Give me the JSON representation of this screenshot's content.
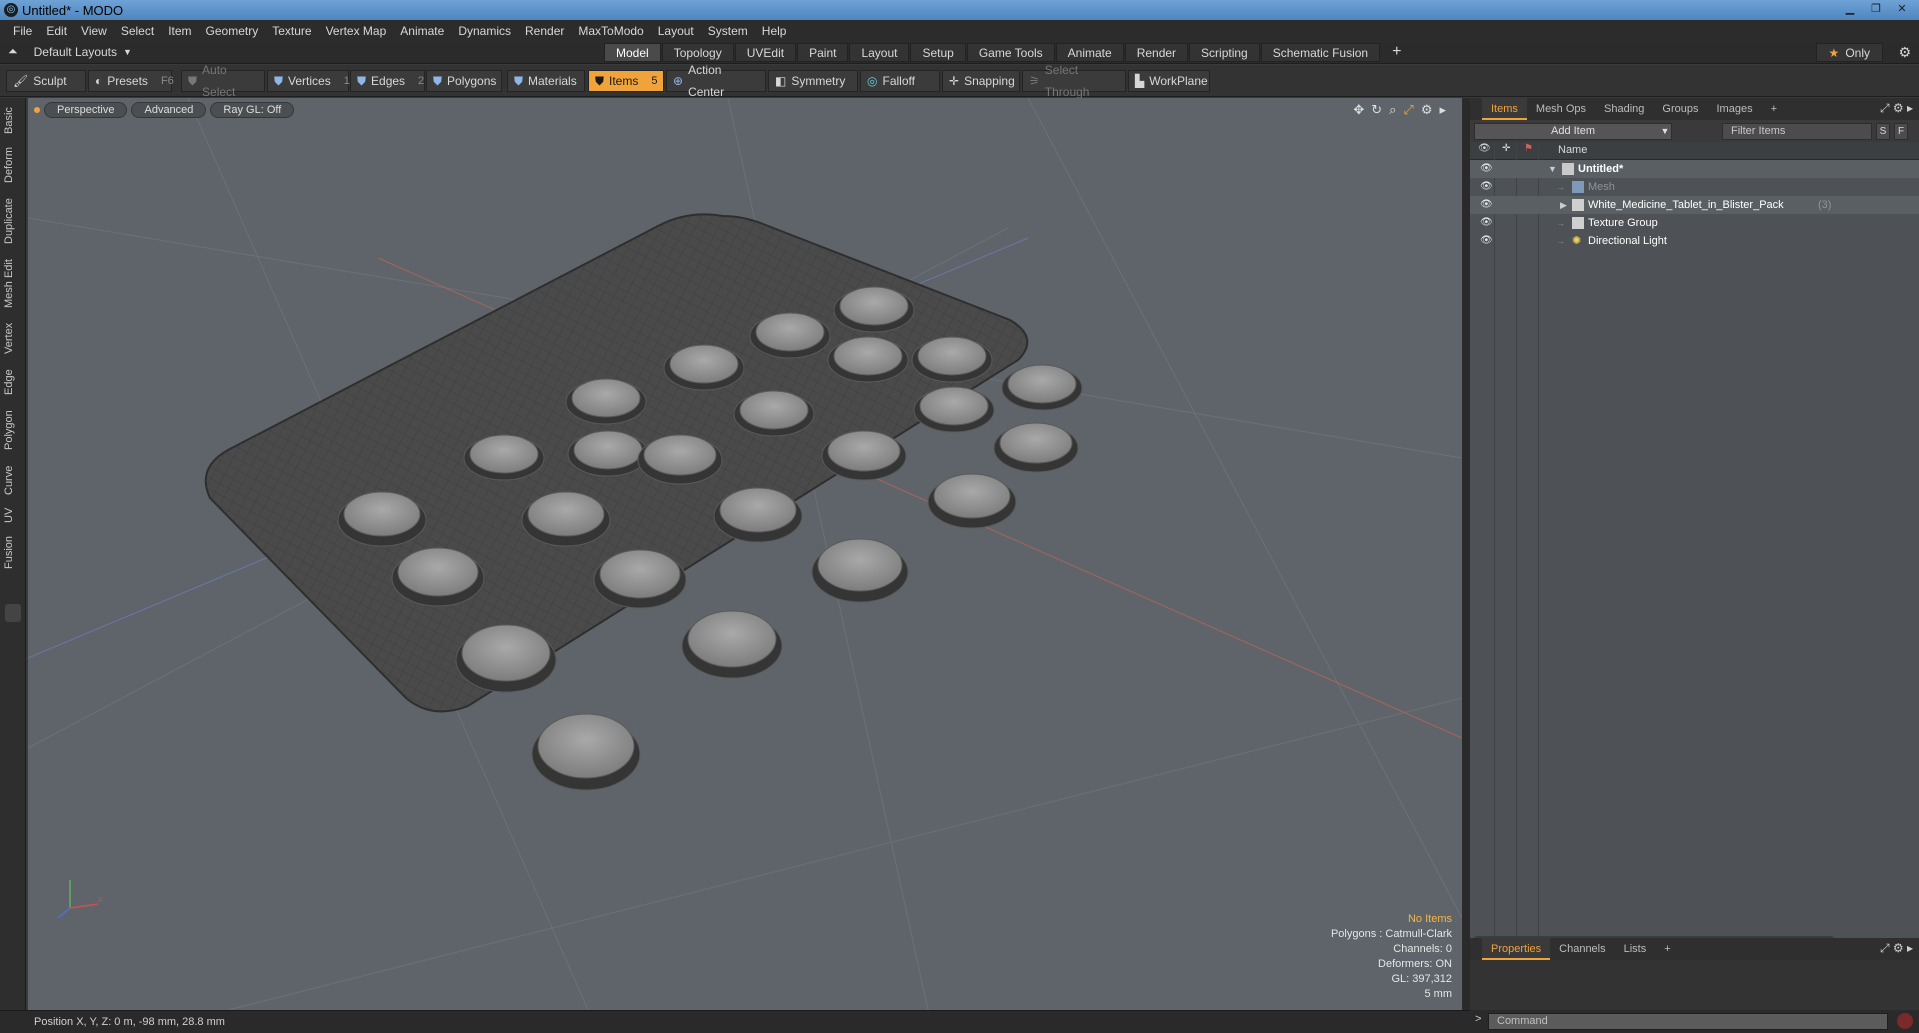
{
  "window": {
    "title": "Untitled* - MODO"
  },
  "menu": [
    "File",
    "Edit",
    "View",
    "Select",
    "Item",
    "Geometry",
    "Texture",
    "Vertex Map",
    "Animate",
    "Dynamics",
    "Render",
    "MaxToModo",
    "Layout",
    "System",
    "Help"
  ],
  "layout": {
    "current": "Default Layouts",
    "tabs": [
      "Model",
      "Topology",
      "UVEdit",
      "Paint",
      "Layout",
      "Setup",
      "Game Tools",
      "Animate",
      "Render",
      "Scripting",
      "Schematic Fusion"
    ],
    "active_tab": "Model",
    "add_tab": "+",
    "only_label": "Only"
  },
  "toolbar": {
    "sculpt": "Sculpt",
    "presets": "Presets",
    "presets_key": "F6",
    "auto_select": "Auto Select",
    "vertices": "Vertices",
    "vertices_key": "1",
    "edges": "Edges",
    "edges_key": "2",
    "polygons": "Polygons",
    "materials": "Materials",
    "items": "Items",
    "items_key": "5",
    "action_center": "Action Center",
    "symmetry": "Symmetry",
    "falloff": "Falloff",
    "snapping": "Snapping",
    "select_through": "Select Through",
    "workplane": "WorkPlane"
  },
  "left_rail": [
    "Basic",
    "Deform",
    "Duplicate",
    "Mesh Edit",
    "Vertex",
    "Edge",
    "Polygon",
    "Curve",
    "UV",
    "Fusion"
  ],
  "viewport": {
    "view": "Perspective",
    "mode": "Advanced",
    "raygl": "Ray GL: Off",
    "info": {
      "status": "No Items",
      "polygons": "Polygons : Catmull-Clark",
      "channels": "Channels: 0",
      "deformers": "Deformers: ON",
      "gl": "GL: 397,312",
      "scale": "5 mm"
    }
  },
  "statusbar": {
    "position": "Position X, Y, Z:  0 m, -98 mm, 28.8 mm"
  },
  "items_panel": {
    "tabs": [
      "Items",
      "Mesh Ops",
      "Shading",
      "Groups",
      "Images"
    ],
    "active_tab": "Items",
    "add_tab": "+",
    "add_item": "Add Item",
    "filter_placeholder": "Filter Items",
    "s_btn": "S",
    "f_btn": "F",
    "name_col": "Name",
    "tree": {
      "root": "Untitled*",
      "mesh": "Mesh",
      "pack": "White_Medicine_Tablet_in_Blister_Pack",
      "pack_count": "(3)",
      "texture_group": "Texture Group",
      "light": "Directional Light"
    }
  },
  "properties_panel": {
    "tabs": [
      "Properties",
      "Channels",
      "Lists"
    ],
    "active_tab": "Properties",
    "add_tab": "+"
  },
  "command": {
    "placeholder": "Command"
  },
  "colors": {
    "accent": "#f0a33a",
    "viewport_bg": "#5e6469",
    "panel_bg": "#4e5256"
  }
}
